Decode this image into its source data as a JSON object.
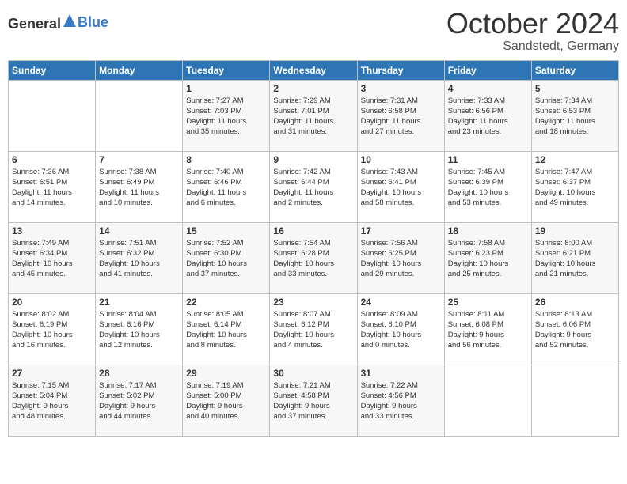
{
  "header": {
    "logo_general": "General",
    "logo_blue": "Blue",
    "month": "October 2024",
    "location": "Sandstedt, Germany"
  },
  "weekdays": [
    "Sunday",
    "Monday",
    "Tuesday",
    "Wednesday",
    "Thursday",
    "Friday",
    "Saturday"
  ],
  "weeks": [
    [
      {
        "day": "",
        "info": ""
      },
      {
        "day": "",
        "info": ""
      },
      {
        "day": "1",
        "info": "Sunrise: 7:27 AM\nSunset: 7:03 PM\nDaylight: 11 hours\nand 35 minutes."
      },
      {
        "day": "2",
        "info": "Sunrise: 7:29 AM\nSunset: 7:01 PM\nDaylight: 11 hours\nand 31 minutes."
      },
      {
        "day": "3",
        "info": "Sunrise: 7:31 AM\nSunset: 6:58 PM\nDaylight: 11 hours\nand 27 minutes."
      },
      {
        "day": "4",
        "info": "Sunrise: 7:33 AM\nSunset: 6:56 PM\nDaylight: 11 hours\nand 23 minutes."
      },
      {
        "day": "5",
        "info": "Sunrise: 7:34 AM\nSunset: 6:53 PM\nDaylight: 11 hours\nand 18 minutes."
      }
    ],
    [
      {
        "day": "6",
        "info": "Sunrise: 7:36 AM\nSunset: 6:51 PM\nDaylight: 11 hours\nand 14 minutes."
      },
      {
        "day": "7",
        "info": "Sunrise: 7:38 AM\nSunset: 6:49 PM\nDaylight: 11 hours\nand 10 minutes."
      },
      {
        "day": "8",
        "info": "Sunrise: 7:40 AM\nSunset: 6:46 PM\nDaylight: 11 hours\nand 6 minutes."
      },
      {
        "day": "9",
        "info": "Sunrise: 7:42 AM\nSunset: 6:44 PM\nDaylight: 11 hours\nand 2 minutes."
      },
      {
        "day": "10",
        "info": "Sunrise: 7:43 AM\nSunset: 6:41 PM\nDaylight: 10 hours\nand 58 minutes."
      },
      {
        "day": "11",
        "info": "Sunrise: 7:45 AM\nSunset: 6:39 PM\nDaylight: 10 hours\nand 53 minutes."
      },
      {
        "day": "12",
        "info": "Sunrise: 7:47 AM\nSunset: 6:37 PM\nDaylight: 10 hours\nand 49 minutes."
      }
    ],
    [
      {
        "day": "13",
        "info": "Sunrise: 7:49 AM\nSunset: 6:34 PM\nDaylight: 10 hours\nand 45 minutes."
      },
      {
        "day": "14",
        "info": "Sunrise: 7:51 AM\nSunset: 6:32 PM\nDaylight: 10 hours\nand 41 minutes."
      },
      {
        "day": "15",
        "info": "Sunrise: 7:52 AM\nSunset: 6:30 PM\nDaylight: 10 hours\nand 37 minutes."
      },
      {
        "day": "16",
        "info": "Sunrise: 7:54 AM\nSunset: 6:28 PM\nDaylight: 10 hours\nand 33 minutes."
      },
      {
        "day": "17",
        "info": "Sunrise: 7:56 AM\nSunset: 6:25 PM\nDaylight: 10 hours\nand 29 minutes."
      },
      {
        "day": "18",
        "info": "Sunrise: 7:58 AM\nSunset: 6:23 PM\nDaylight: 10 hours\nand 25 minutes."
      },
      {
        "day": "19",
        "info": "Sunrise: 8:00 AM\nSunset: 6:21 PM\nDaylight: 10 hours\nand 21 minutes."
      }
    ],
    [
      {
        "day": "20",
        "info": "Sunrise: 8:02 AM\nSunset: 6:19 PM\nDaylight: 10 hours\nand 16 minutes."
      },
      {
        "day": "21",
        "info": "Sunrise: 8:04 AM\nSunset: 6:16 PM\nDaylight: 10 hours\nand 12 minutes."
      },
      {
        "day": "22",
        "info": "Sunrise: 8:05 AM\nSunset: 6:14 PM\nDaylight: 10 hours\nand 8 minutes."
      },
      {
        "day": "23",
        "info": "Sunrise: 8:07 AM\nSunset: 6:12 PM\nDaylight: 10 hours\nand 4 minutes."
      },
      {
        "day": "24",
        "info": "Sunrise: 8:09 AM\nSunset: 6:10 PM\nDaylight: 10 hours\nand 0 minutes."
      },
      {
        "day": "25",
        "info": "Sunrise: 8:11 AM\nSunset: 6:08 PM\nDaylight: 9 hours\nand 56 minutes."
      },
      {
        "day": "26",
        "info": "Sunrise: 8:13 AM\nSunset: 6:06 PM\nDaylight: 9 hours\nand 52 minutes."
      }
    ],
    [
      {
        "day": "27",
        "info": "Sunrise: 7:15 AM\nSunset: 5:04 PM\nDaylight: 9 hours\nand 48 minutes."
      },
      {
        "day": "28",
        "info": "Sunrise: 7:17 AM\nSunset: 5:02 PM\nDaylight: 9 hours\nand 44 minutes."
      },
      {
        "day": "29",
        "info": "Sunrise: 7:19 AM\nSunset: 5:00 PM\nDaylight: 9 hours\nand 40 minutes."
      },
      {
        "day": "30",
        "info": "Sunrise: 7:21 AM\nSunset: 4:58 PM\nDaylight: 9 hours\nand 37 minutes."
      },
      {
        "day": "31",
        "info": "Sunrise: 7:22 AM\nSunset: 4:56 PM\nDaylight: 9 hours\nand 33 minutes."
      },
      {
        "day": "",
        "info": ""
      },
      {
        "day": "",
        "info": ""
      }
    ]
  ]
}
